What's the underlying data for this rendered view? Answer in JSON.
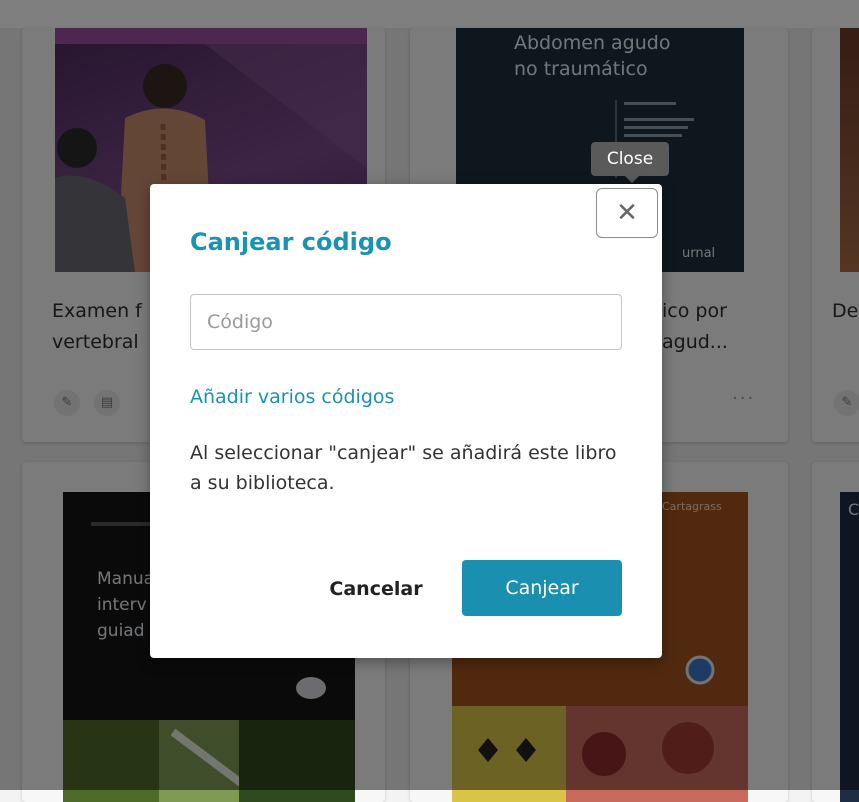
{
  "books": [
    {
      "title_line1": "Examen f",
      "title_line2": "vertebral"
    },
    {
      "title_line1": "ico por",
      "title_line2": "agud...",
      "cover_title": "Abdomen agudo\nno traumático",
      "cover_footer": "urnal"
    },
    {
      "title_line1": "De"
    },
    {
      "cover_title": "Manua\ninterv\nguiad"
    },
    {
      "cover_author": "Cartagrass"
    },
    {
      "cover_letter": "C"
    }
  ],
  "card_tools": {
    "edit_icon": "✎",
    "notes_icon": "▤",
    "more_icon": "···"
  },
  "tooltip": {
    "close_label": "Close"
  },
  "dialog": {
    "close_icon": "✕",
    "title": "Canjear código",
    "code_placeholder": "Código",
    "add_multiple_link": "Añadir varios códigos",
    "info_text": "Al seleccionar \"canjear\" se añadirá este libro a su biblioteca.",
    "cancel_label": "Cancelar",
    "redeem_label": "Canjear"
  },
  "colors": {
    "accent": "#1a93b3",
    "button": "#1a8fb0",
    "overlay": "rgba(0,0,0,0.5)"
  }
}
